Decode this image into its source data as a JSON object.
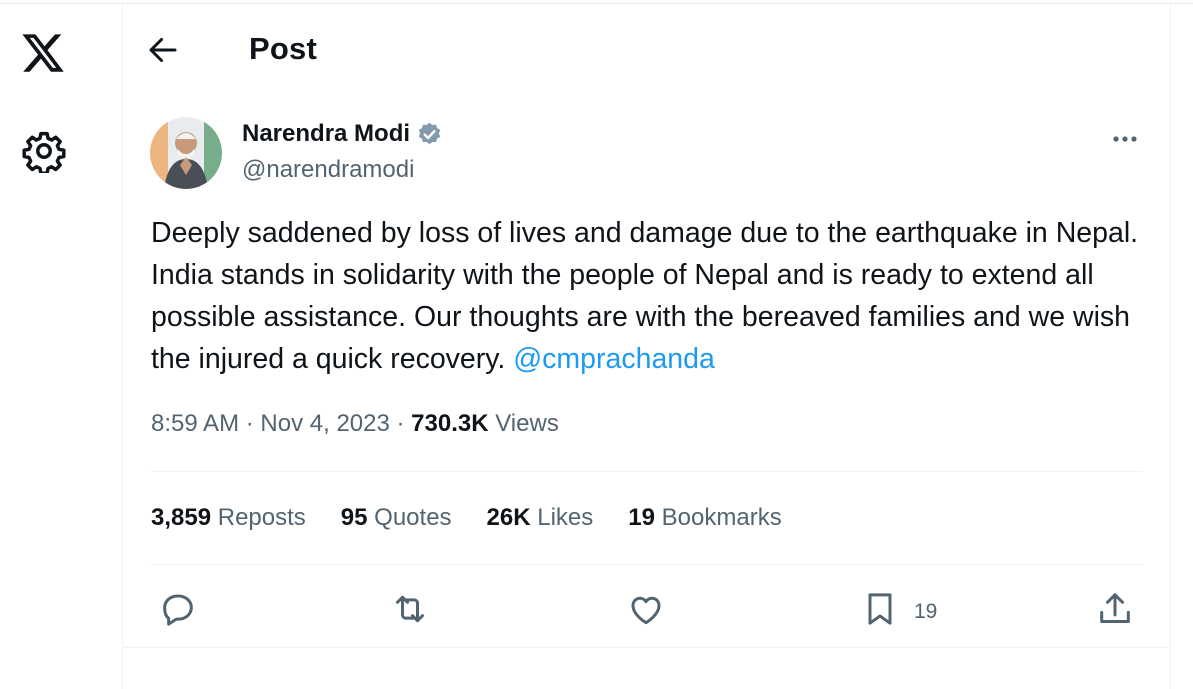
{
  "header": {
    "title": "Post"
  },
  "author": {
    "name": "Narendra Modi",
    "handle": "@narendramodi",
    "verified_badge_color": "#829aab"
  },
  "tweet": {
    "text": "Deeply saddened by loss of lives and damage due to the earthquake in Nepal. India stands in solidarity with the people of Nepal and is ready to extend all possible assistance. Our thoughts are with the bereaved families and we wish the injured a quick recovery. ",
    "mention": "@cmprachanda"
  },
  "meta": {
    "time": "8:59 AM",
    "separator": "·",
    "date": "Nov 4, 2023",
    "views_count": "730.3K",
    "views_label": "Views"
  },
  "stats": [
    {
      "count": "3,859",
      "label": "Reposts"
    },
    {
      "count": "95",
      "label": "Quotes"
    },
    {
      "count": "26K",
      "label": "Likes"
    },
    {
      "count": "19",
      "label": "Bookmarks"
    }
  ],
  "actions": {
    "bookmark_count": "19"
  },
  "icons": [
    "x-logo-icon",
    "gear-icon",
    "back-arrow-icon",
    "verified-badge-icon",
    "more-icon",
    "reply-icon",
    "repost-icon",
    "like-icon",
    "bookmark-icon",
    "share-icon"
  ],
  "colors": {
    "text": "#0f1419",
    "secondary": "#536471",
    "link": "#1d9bf0",
    "border": "#eff3f4"
  }
}
